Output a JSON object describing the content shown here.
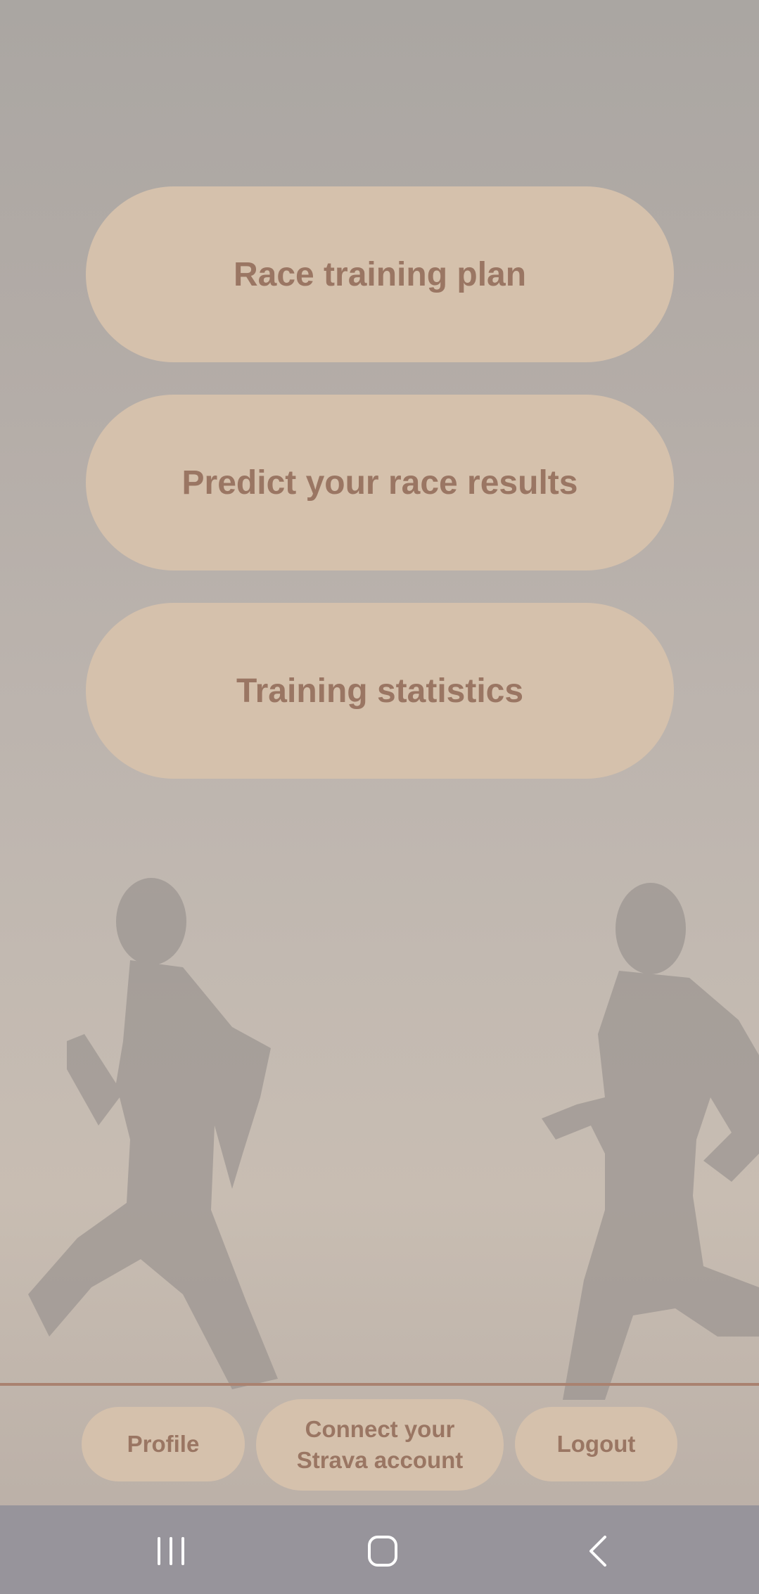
{
  "menu": {
    "race_training_plan": "Race training plan",
    "predict_results": "Predict your race results",
    "training_statistics": "Training statistics"
  },
  "bottom_nav": {
    "profile": "Profile",
    "connect_strava_line1": "Connect your",
    "connect_strava_line2": "Strava account",
    "logout": "Logout"
  },
  "system_nav": {
    "recents_icon": "recents-icon",
    "home_icon": "home-icon",
    "back_icon": "back-icon"
  },
  "colors": {
    "button_bg": "#d5c1ac",
    "button_text": "#9a7663",
    "divider": "#a98270",
    "system_bar": "#97949b"
  }
}
